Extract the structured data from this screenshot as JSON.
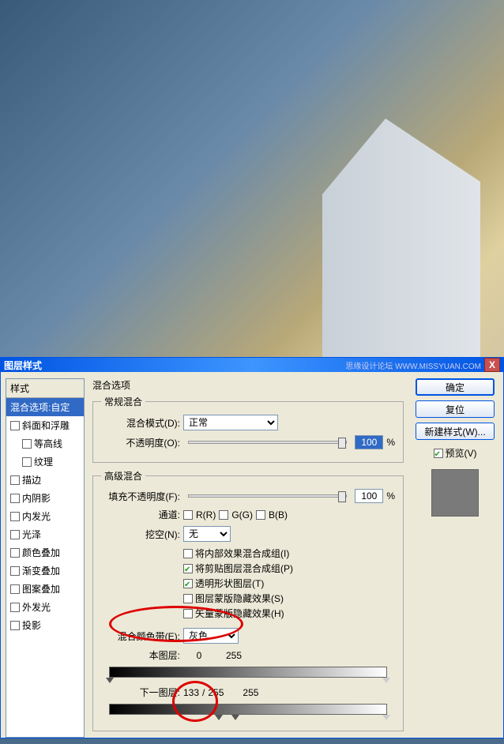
{
  "titlebar": {
    "title": "图层样式",
    "watermark": "思缘设计论坛 WWW.MISSYUAN.COM",
    "close": "X"
  },
  "styles": {
    "header": "样式",
    "selected": "混合选项:自定",
    "items": [
      "斜面和浮雕",
      "等高线",
      "纹理",
      "描边",
      "内阴影",
      "内发光",
      "光泽",
      "颜色叠加",
      "渐变叠加",
      "图案叠加",
      "外发光",
      "投影"
    ]
  },
  "blend": {
    "group_title": "混合选项",
    "normal": {
      "legend": "常规混合",
      "mode_label": "混合模式(D):",
      "mode_value": "正常",
      "opacity_label": "不透明度(O):",
      "opacity_value": "100",
      "pct": "%"
    },
    "advanced": {
      "legend": "高级混合",
      "fill_label": "填充不透明度(F):",
      "fill_value": "100",
      "pct": "%",
      "channels_label": "通道:",
      "r": "R(R)",
      "g": "G(G)",
      "b": "B(B)",
      "knockout_label": "挖空(N):",
      "knockout_value": "无",
      "opts": [
        "将内部效果混合成组(I)",
        "将剪贴图层混合成组(P)",
        "透明形状图层(T)",
        "图层蒙版隐藏效果(S)",
        "矢量蒙版隐藏效果(H)"
      ],
      "opts_checked": [
        false,
        true,
        true,
        false,
        false
      ],
      "blendif_label": "混合颜色带(E):",
      "blendif_value": "灰色",
      "this_layer": "本图层:",
      "this_vals": {
        "lo": "0",
        "hi": "255"
      },
      "under_layer": "下一图层:",
      "under_vals": {
        "lo": "133",
        "mid": "255",
        "hi": "255",
        "sep": " / "
      }
    }
  },
  "rpanel": {
    "ok": "确定",
    "cancel": "复位",
    "newstyle": "新建样式(W)...",
    "preview": "预览(V)"
  }
}
